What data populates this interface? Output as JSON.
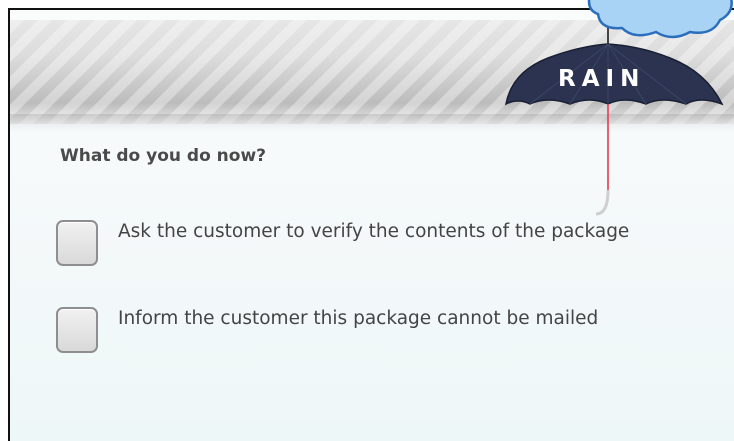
{
  "header": {
    "brand_label": "RAIN"
  },
  "question": {
    "text": "What do you do now?"
  },
  "options": [
    {
      "label": "Ask the customer to verify the contents of the package",
      "checked": false
    },
    {
      "label": "Inform the customer this package cannot be mailed",
      "checked": false
    }
  ],
  "colors": {
    "cloud_fill": "#a9d3f4",
    "cloud_stroke": "#2a6fbd",
    "umbrella_canopy": "#2b3350",
    "umbrella_pole": "#e8465a",
    "text": "#444444"
  },
  "icons": {
    "cloud": "cloud-icon",
    "umbrella": "umbrella-icon"
  }
}
